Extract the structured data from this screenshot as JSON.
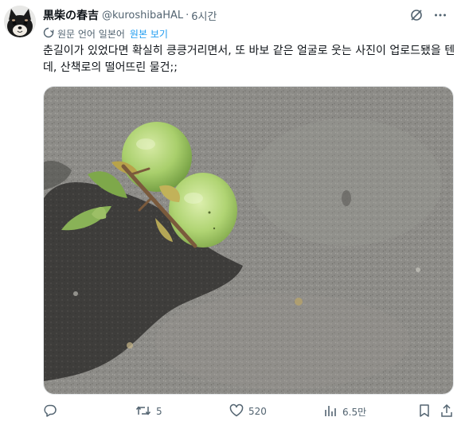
{
  "author": {
    "display_name": "黒柴の春吉",
    "handle": "@kuroshibaHAL",
    "separator": "·",
    "time": "6시간"
  },
  "translation": {
    "label": "원문 언어 일본어",
    "link": "원본 보기"
  },
  "tweet_text": "춘길이가 있었다면 확실히 킁킁거리면서, 또 바보 같은 얼굴로 웃는 사진이 업로드됐을 텐데, 산책로의 떨어뜨린 물건;;",
  "actions": {
    "replies": "",
    "retweets": "5",
    "likes": "520",
    "views": "6.5만"
  },
  "colors": {
    "accent": "#1d9bf0",
    "muted": "#536471",
    "text": "#0f1419"
  },
  "icons": [
    "reply-icon",
    "retweet-icon",
    "like-icon",
    "views-icon",
    "bookmark-icon",
    "share-icon",
    "grok-icon",
    "more-icon",
    "translate-icon"
  ]
}
